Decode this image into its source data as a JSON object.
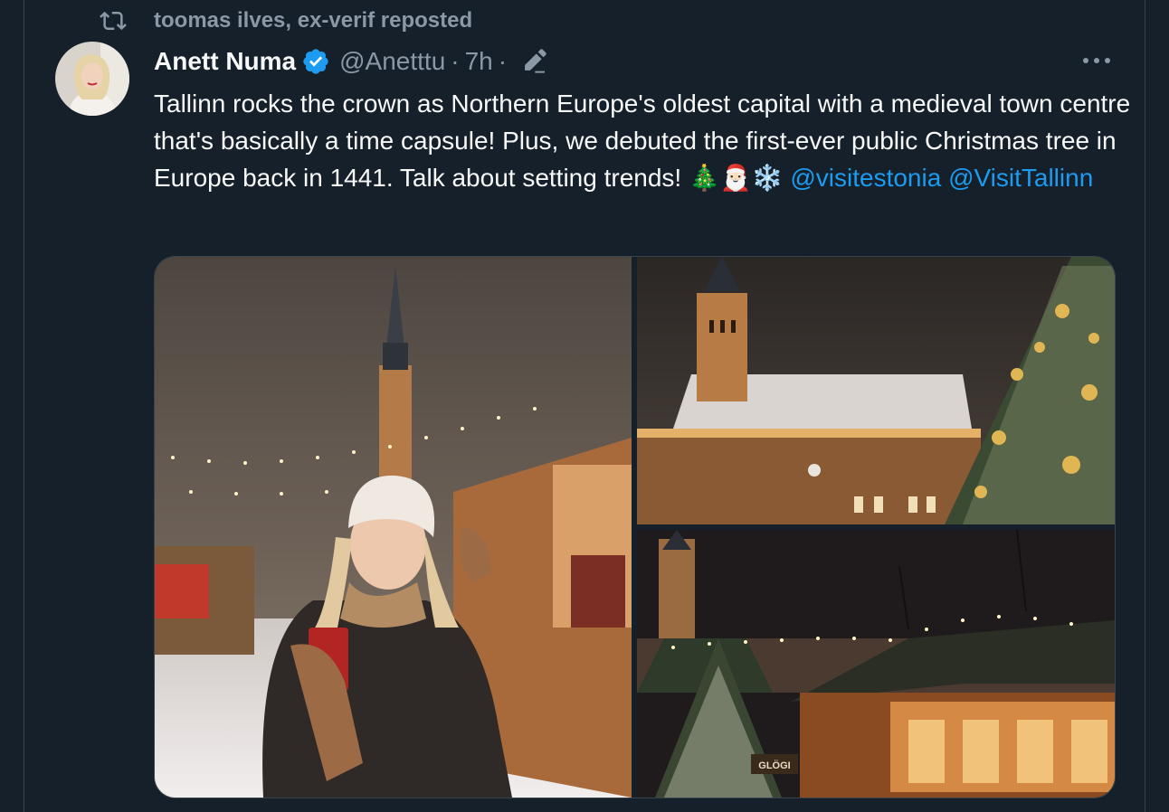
{
  "repost": {
    "icon": "repost-icon",
    "text": "toomas ilves, ex-verif reposted"
  },
  "post": {
    "author_name": "Anett Numa",
    "verified_icon": "verified-badge-icon",
    "handle": "@Anetttu",
    "separator": "·",
    "time": "7h",
    "edited_icon": "edit-pencil-icon",
    "more_icon": "more-options-icon",
    "text_main": "Tallinn rocks the crown as Northern Europe's oldest capital with a medieval town centre that's basically a time capsule! Plus, we debuted the first-ever public Christmas tree in Europe back in 1441. Talk about setting trends! 🎄🎅🏻❄️",
    "mention_1": "@visitestonia",
    "mention_2": "@VisitTallinn"
  },
  "media": {
    "photos": [
      "woman-christmas-market-photo",
      "town-hall-christmas-tree-photo",
      "market-stalls-night-photo"
    ],
    "stall_sign": "GLÖGI"
  },
  "colors": {
    "background": "#15202b",
    "text": "#f7f9f9",
    "secondary": "#8b98a5",
    "accent": "#1d9bf0",
    "border": "#38444d"
  }
}
